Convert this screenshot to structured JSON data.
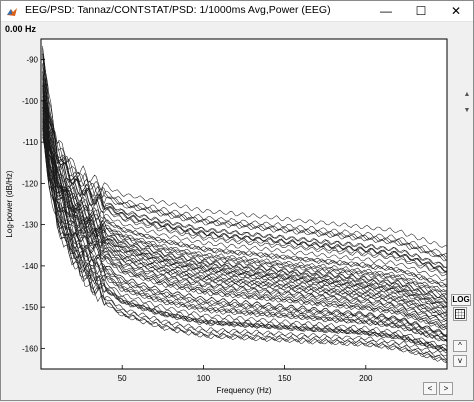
{
  "window": {
    "title": "EEG/PSD: Tannaz/CONTSTAT/PSD: 1/1000ms Avg,Power (EEG)",
    "minimize_glyph": "—",
    "maximize_glyph": "☐",
    "close_glyph": "✕",
    "icon": "matlab-icon"
  },
  "frequency_readout": "0.00 Hz",
  "controls": {
    "log_label": "LOG",
    "grid_icon": "grid-icon",
    "amp_up_label": "^",
    "amp_down_label": "v",
    "time_left_label": "<",
    "time_right_label": ">",
    "scroll_up_icon": "scroll-up-arrow-icon",
    "scroll_down_icon": "scroll-down-arrow-icon"
  },
  "colors": {
    "trace": "#1a1a1a",
    "plot_bg": "#ffffff",
    "frame_bg": "#f0f0f0"
  },
  "chart_data": {
    "type": "line",
    "title": "",
    "xlabel": "Frequency (Hz)",
    "ylabel": "Log-power (dB/Hz)",
    "xlim": [
      0,
      250
    ],
    "ylim": [
      -165,
      -85
    ],
    "xticks": [
      50,
      100,
      150,
      200
    ],
    "xtick_labels": [
      "50",
      "100",
      "150",
      "200"
    ],
    "yticks": [
      -90,
      -100,
      -110,
      -120,
      -130,
      -140,
      -150,
      -160
    ],
    "ytick_labels": [
      "-90",
      "-100",
      "-110",
      "-120",
      "-130",
      "-140",
      "-150",
      "-160"
    ],
    "grid": false,
    "legend": "none",
    "channel_count": 64,
    "representative_series": [
      {
        "x": [
          1,
          5,
          10,
          20,
          30,
          40,
          50,
          75,
          100,
          150,
          200,
          220,
          250
        ],
        "y": [
          -86,
          -100,
          -110,
          -116,
          -119,
          -121,
          -123,
          -125,
          -127,
          -129,
          -131,
          -132,
          -136
        ]
      },
      {
        "x": [
          1,
          5,
          10,
          20,
          30,
          40,
          50,
          75,
          100,
          150,
          200,
          220,
          250
        ],
        "y": [
          -95,
          -108,
          -117,
          -124,
          -128,
          -131,
          -133,
          -136,
          -138,
          -140,
          -142,
          -143,
          -147
        ]
      },
      {
        "x": [
          1,
          5,
          10,
          20,
          30,
          40,
          50,
          75,
          100,
          150,
          200,
          220,
          250
        ],
        "y": [
          -102,
          -113,
          -122,
          -131,
          -135,
          -138,
          -141,
          -144,
          -146,
          -148,
          -150,
          -151,
          -155
        ]
      },
      {
        "x": [
          1,
          5,
          10,
          20,
          30,
          40,
          50,
          75,
          100,
          150,
          200,
          220,
          250
        ],
        "y": [
          -108,
          -120,
          -130,
          -139,
          -145,
          -149,
          -152,
          -155,
          -157,
          -158,
          -159,
          -160,
          -163
        ]
      }
    ]
  }
}
